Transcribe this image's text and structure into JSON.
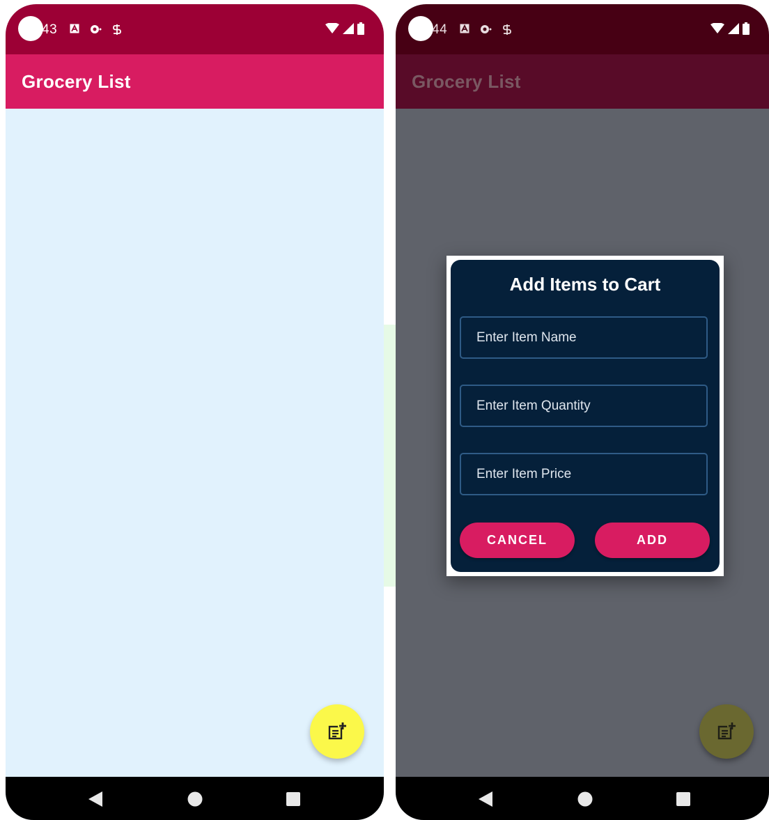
{
  "left_screen": {
    "status": {
      "time": "43"
    },
    "app_bar": {
      "title": "Grocery List"
    },
    "fab": {
      "icon": "add-note-icon"
    },
    "colors": {
      "status": "#9c0035",
      "app_bar": "#d81c61",
      "background": "#e1f2fd",
      "fab": "#fbf84a"
    }
  },
  "right_screen": {
    "status": {
      "time": "44"
    },
    "app_bar": {
      "title": "Grocery List"
    },
    "dialog": {
      "title": "Add Items to Cart",
      "name_placeholder": "Enter Item Name",
      "quantity_placeholder": "Enter Item Quantity",
      "price_placeholder": "Enter Item Price",
      "cancel_label": "CANCEL",
      "add_label": "ADD"
    },
    "fab": {
      "icon": "add-note-icon"
    },
    "colors": {
      "dialog": "#05203a",
      "button": "#d81c61",
      "scrim": "#5f626a"
    }
  },
  "nav": {
    "icons": [
      "back-icon",
      "home-icon",
      "recents-icon"
    ]
  }
}
